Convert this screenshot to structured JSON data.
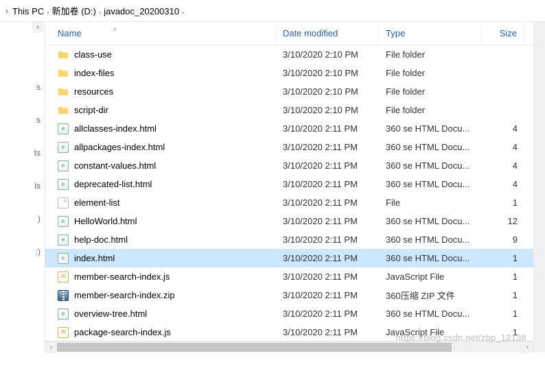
{
  "breadcrumb": {
    "items": [
      "This PC",
      "新加卷 (D:)",
      "javadoc_20200310"
    ]
  },
  "leftLabels": [
    "s",
    "s",
    "ts",
    "ls",
    ")",
    ":)"
  ],
  "columns": {
    "name": "Name",
    "date": "Date modified",
    "type": "Type",
    "size": "Size"
  },
  "files": [
    {
      "icon": "folder",
      "name": "class-use",
      "date": "3/10/2020 2:10 PM",
      "type": "File folder",
      "size": ""
    },
    {
      "icon": "folder",
      "name": "index-files",
      "date": "3/10/2020 2:10 PM",
      "type": "File folder",
      "size": ""
    },
    {
      "icon": "folder",
      "name": "resources",
      "date": "3/10/2020 2:10 PM",
      "type": "File folder",
      "size": ""
    },
    {
      "icon": "folder",
      "name": "script-dir",
      "date": "3/10/2020 2:10 PM",
      "type": "File folder",
      "size": ""
    },
    {
      "icon": "html",
      "name": "allclasses-index.html",
      "date": "3/10/2020 2:11 PM",
      "type": "360 se HTML Docu...",
      "size": "4"
    },
    {
      "icon": "html",
      "name": "allpackages-index.html",
      "date": "3/10/2020 2:11 PM",
      "type": "360 se HTML Docu...",
      "size": "4"
    },
    {
      "icon": "html",
      "name": "constant-values.html",
      "date": "3/10/2020 2:11 PM",
      "type": "360 se HTML Docu...",
      "size": "4"
    },
    {
      "icon": "html",
      "name": "deprecated-list.html",
      "date": "3/10/2020 2:11 PM",
      "type": "360 se HTML Docu...",
      "size": "4"
    },
    {
      "icon": "file",
      "name": "element-list",
      "date": "3/10/2020 2:11 PM",
      "type": "File",
      "size": "1"
    },
    {
      "icon": "html",
      "name": "HelloWorld.html",
      "date": "3/10/2020 2:11 PM",
      "type": "360 se HTML Docu...",
      "size": "12"
    },
    {
      "icon": "html",
      "name": "help-doc.html",
      "date": "3/10/2020 2:11 PM",
      "type": "360 se HTML Docu...",
      "size": "9"
    },
    {
      "icon": "html",
      "name": "index.html",
      "date": "3/10/2020 2:11 PM",
      "type": "360 se HTML Docu...",
      "size": "1",
      "selected": true
    },
    {
      "icon": "js",
      "name": "member-search-index.js",
      "date": "3/10/2020 2:11 PM",
      "type": "JavaScript File",
      "size": "1"
    },
    {
      "icon": "zip",
      "name": "member-search-index.zip",
      "date": "3/10/2020 2:11 PM",
      "type": "360压缩 ZIP 文件",
      "size": "1"
    },
    {
      "icon": "html",
      "name": "overview-tree.html",
      "date": "3/10/2020 2:11 PM",
      "type": "360 se HTML Docu...",
      "size": "1"
    },
    {
      "icon": "js",
      "name": "package-search-index.js",
      "date": "3/10/2020 2:11 PM",
      "type": "JavaScript File",
      "size": "1"
    }
  ],
  "watermark": "https://blog.csdn.net/zbp_12138"
}
